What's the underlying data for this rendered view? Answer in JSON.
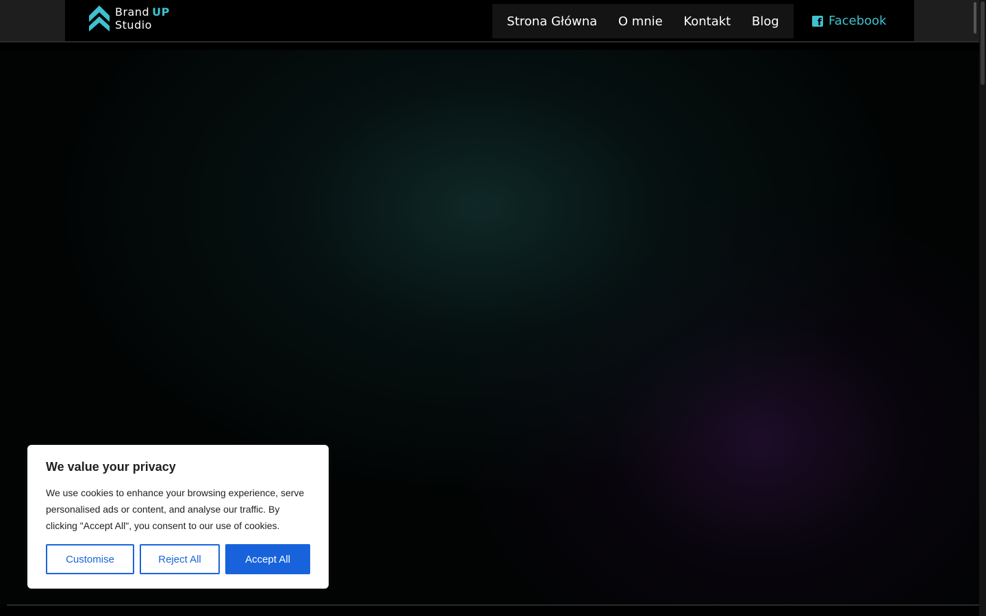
{
  "header": {
    "logo": {
      "line1": "Brand",
      "accent": "UP",
      "line2": "Studio",
      "accent_color": "#3fc1d0"
    },
    "nav": [
      {
        "label": "Strona Główna"
      },
      {
        "label": "O mnie"
      },
      {
        "label": "Kontakt"
      },
      {
        "label": "Blog"
      }
    ],
    "facebook": {
      "label": "Facebook",
      "icon": "facebook-icon"
    }
  },
  "cookie_banner": {
    "title": "We value your privacy",
    "text": "We use cookies to enhance your browsing experience, serve personalised ads or content, and analyse our traffic. By clicking \"Accept All\", you consent to our use of cookies.",
    "buttons": {
      "customise": "Customise",
      "reject": "Reject All",
      "accept": "Accept All"
    },
    "accent_color": "#1863dc"
  }
}
